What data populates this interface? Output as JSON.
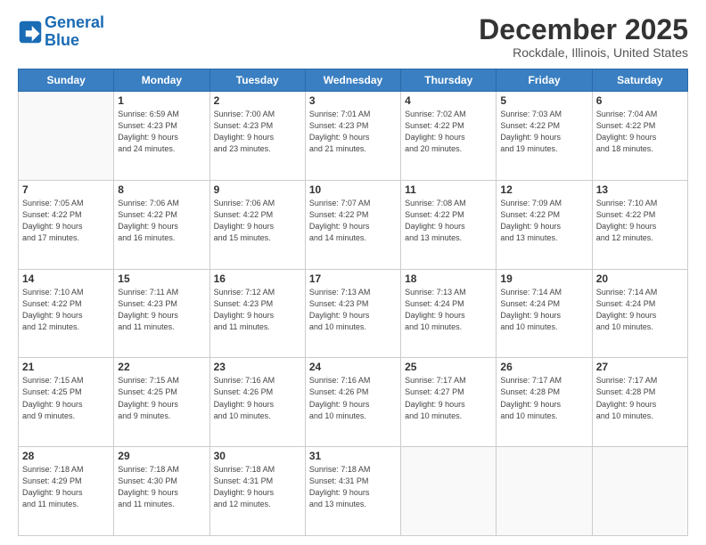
{
  "header": {
    "logo_line1": "General",
    "logo_line2": "Blue",
    "month": "December 2025",
    "location": "Rockdale, Illinois, United States"
  },
  "days_of_week": [
    "Sunday",
    "Monday",
    "Tuesday",
    "Wednesday",
    "Thursday",
    "Friday",
    "Saturday"
  ],
  "weeks": [
    [
      {
        "day": "",
        "info": ""
      },
      {
        "day": "1",
        "info": "Sunrise: 6:59 AM\nSunset: 4:23 PM\nDaylight: 9 hours\nand 24 minutes."
      },
      {
        "day": "2",
        "info": "Sunrise: 7:00 AM\nSunset: 4:23 PM\nDaylight: 9 hours\nand 23 minutes."
      },
      {
        "day": "3",
        "info": "Sunrise: 7:01 AM\nSunset: 4:23 PM\nDaylight: 9 hours\nand 21 minutes."
      },
      {
        "day": "4",
        "info": "Sunrise: 7:02 AM\nSunset: 4:22 PM\nDaylight: 9 hours\nand 20 minutes."
      },
      {
        "day": "5",
        "info": "Sunrise: 7:03 AM\nSunset: 4:22 PM\nDaylight: 9 hours\nand 19 minutes."
      },
      {
        "day": "6",
        "info": "Sunrise: 7:04 AM\nSunset: 4:22 PM\nDaylight: 9 hours\nand 18 minutes."
      }
    ],
    [
      {
        "day": "7",
        "info": "Sunrise: 7:05 AM\nSunset: 4:22 PM\nDaylight: 9 hours\nand 17 minutes."
      },
      {
        "day": "8",
        "info": "Sunrise: 7:06 AM\nSunset: 4:22 PM\nDaylight: 9 hours\nand 16 minutes."
      },
      {
        "day": "9",
        "info": "Sunrise: 7:06 AM\nSunset: 4:22 PM\nDaylight: 9 hours\nand 15 minutes."
      },
      {
        "day": "10",
        "info": "Sunrise: 7:07 AM\nSunset: 4:22 PM\nDaylight: 9 hours\nand 14 minutes."
      },
      {
        "day": "11",
        "info": "Sunrise: 7:08 AM\nSunset: 4:22 PM\nDaylight: 9 hours\nand 13 minutes."
      },
      {
        "day": "12",
        "info": "Sunrise: 7:09 AM\nSunset: 4:22 PM\nDaylight: 9 hours\nand 13 minutes."
      },
      {
        "day": "13",
        "info": "Sunrise: 7:10 AM\nSunset: 4:22 PM\nDaylight: 9 hours\nand 12 minutes."
      }
    ],
    [
      {
        "day": "14",
        "info": "Sunrise: 7:10 AM\nSunset: 4:22 PM\nDaylight: 9 hours\nand 12 minutes."
      },
      {
        "day": "15",
        "info": "Sunrise: 7:11 AM\nSunset: 4:23 PM\nDaylight: 9 hours\nand 11 minutes."
      },
      {
        "day": "16",
        "info": "Sunrise: 7:12 AM\nSunset: 4:23 PM\nDaylight: 9 hours\nand 11 minutes."
      },
      {
        "day": "17",
        "info": "Sunrise: 7:13 AM\nSunset: 4:23 PM\nDaylight: 9 hours\nand 10 minutes."
      },
      {
        "day": "18",
        "info": "Sunrise: 7:13 AM\nSunset: 4:24 PM\nDaylight: 9 hours\nand 10 minutes."
      },
      {
        "day": "19",
        "info": "Sunrise: 7:14 AM\nSunset: 4:24 PM\nDaylight: 9 hours\nand 10 minutes."
      },
      {
        "day": "20",
        "info": "Sunrise: 7:14 AM\nSunset: 4:24 PM\nDaylight: 9 hours\nand 10 minutes."
      }
    ],
    [
      {
        "day": "21",
        "info": "Sunrise: 7:15 AM\nSunset: 4:25 PM\nDaylight: 9 hours\nand 9 minutes."
      },
      {
        "day": "22",
        "info": "Sunrise: 7:15 AM\nSunset: 4:25 PM\nDaylight: 9 hours\nand 9 minutes."
      },
      {
        "day": "23",
        "info": "Sunrise: 7:16 AM\nSunset: 4:26 PM\nDaylight: 9 hours\nand 10 minutes."
      },
      {
        "day": "24",
        "info": "Sunrise: 7:16 AM\nSunset: 4:26 PM\nDaylight: 9 hours\nand 10 minutes."
      },
      {
        "day": "25",
        "info": "Sunrise: 7:17 AM\nSunset: 4:27 PM\nDaylight: 9 hours\nand 10 minutes."
      },
      {
        "day": "26",
        "info": "Sunrise: 7:17 AM\nSunset: 4:28 PM\nDaylight: 9 hours\nand 10 minutes."
      },
      {
        "day": "27",
        "info": "Sunrise: 7:17 AM\nSunset: 4:28 PM\nDaylight: 9 hours\nand 10 minutes."
      }
    ],
    [
      {
        "day": "28",
        "info": "Sunrise: 7:18 AM\nSunset: 4:29 PM\nDaylight: 9 hours\nand 11 minutes."
      },
      {
        "day": "29",
        "info": "Sunrise: 7:18 AM\nSunset: 4:30 PM\nDaylight: 9 hours\nand 11 minutes."
      },
      {
        "day": "30",
        "info": "Sunrise: 7:18 AM\nSunset: 4:31 PM\nDaylight: 9 hours\nand 12 minutes."
      },
      {
        "day": "31",
        "info": "Sunrise: 7:18 AM\nSunset: 4:31 PM\nDaylight: 9 hours\nand 13 minutes."
      },
      {
        "day": "",
        "info": ""
      },
      {
        "day": "",
        "info": ""
      },
      {
        "day": "",
        "info": ""
      }
    ]
  ]
}
